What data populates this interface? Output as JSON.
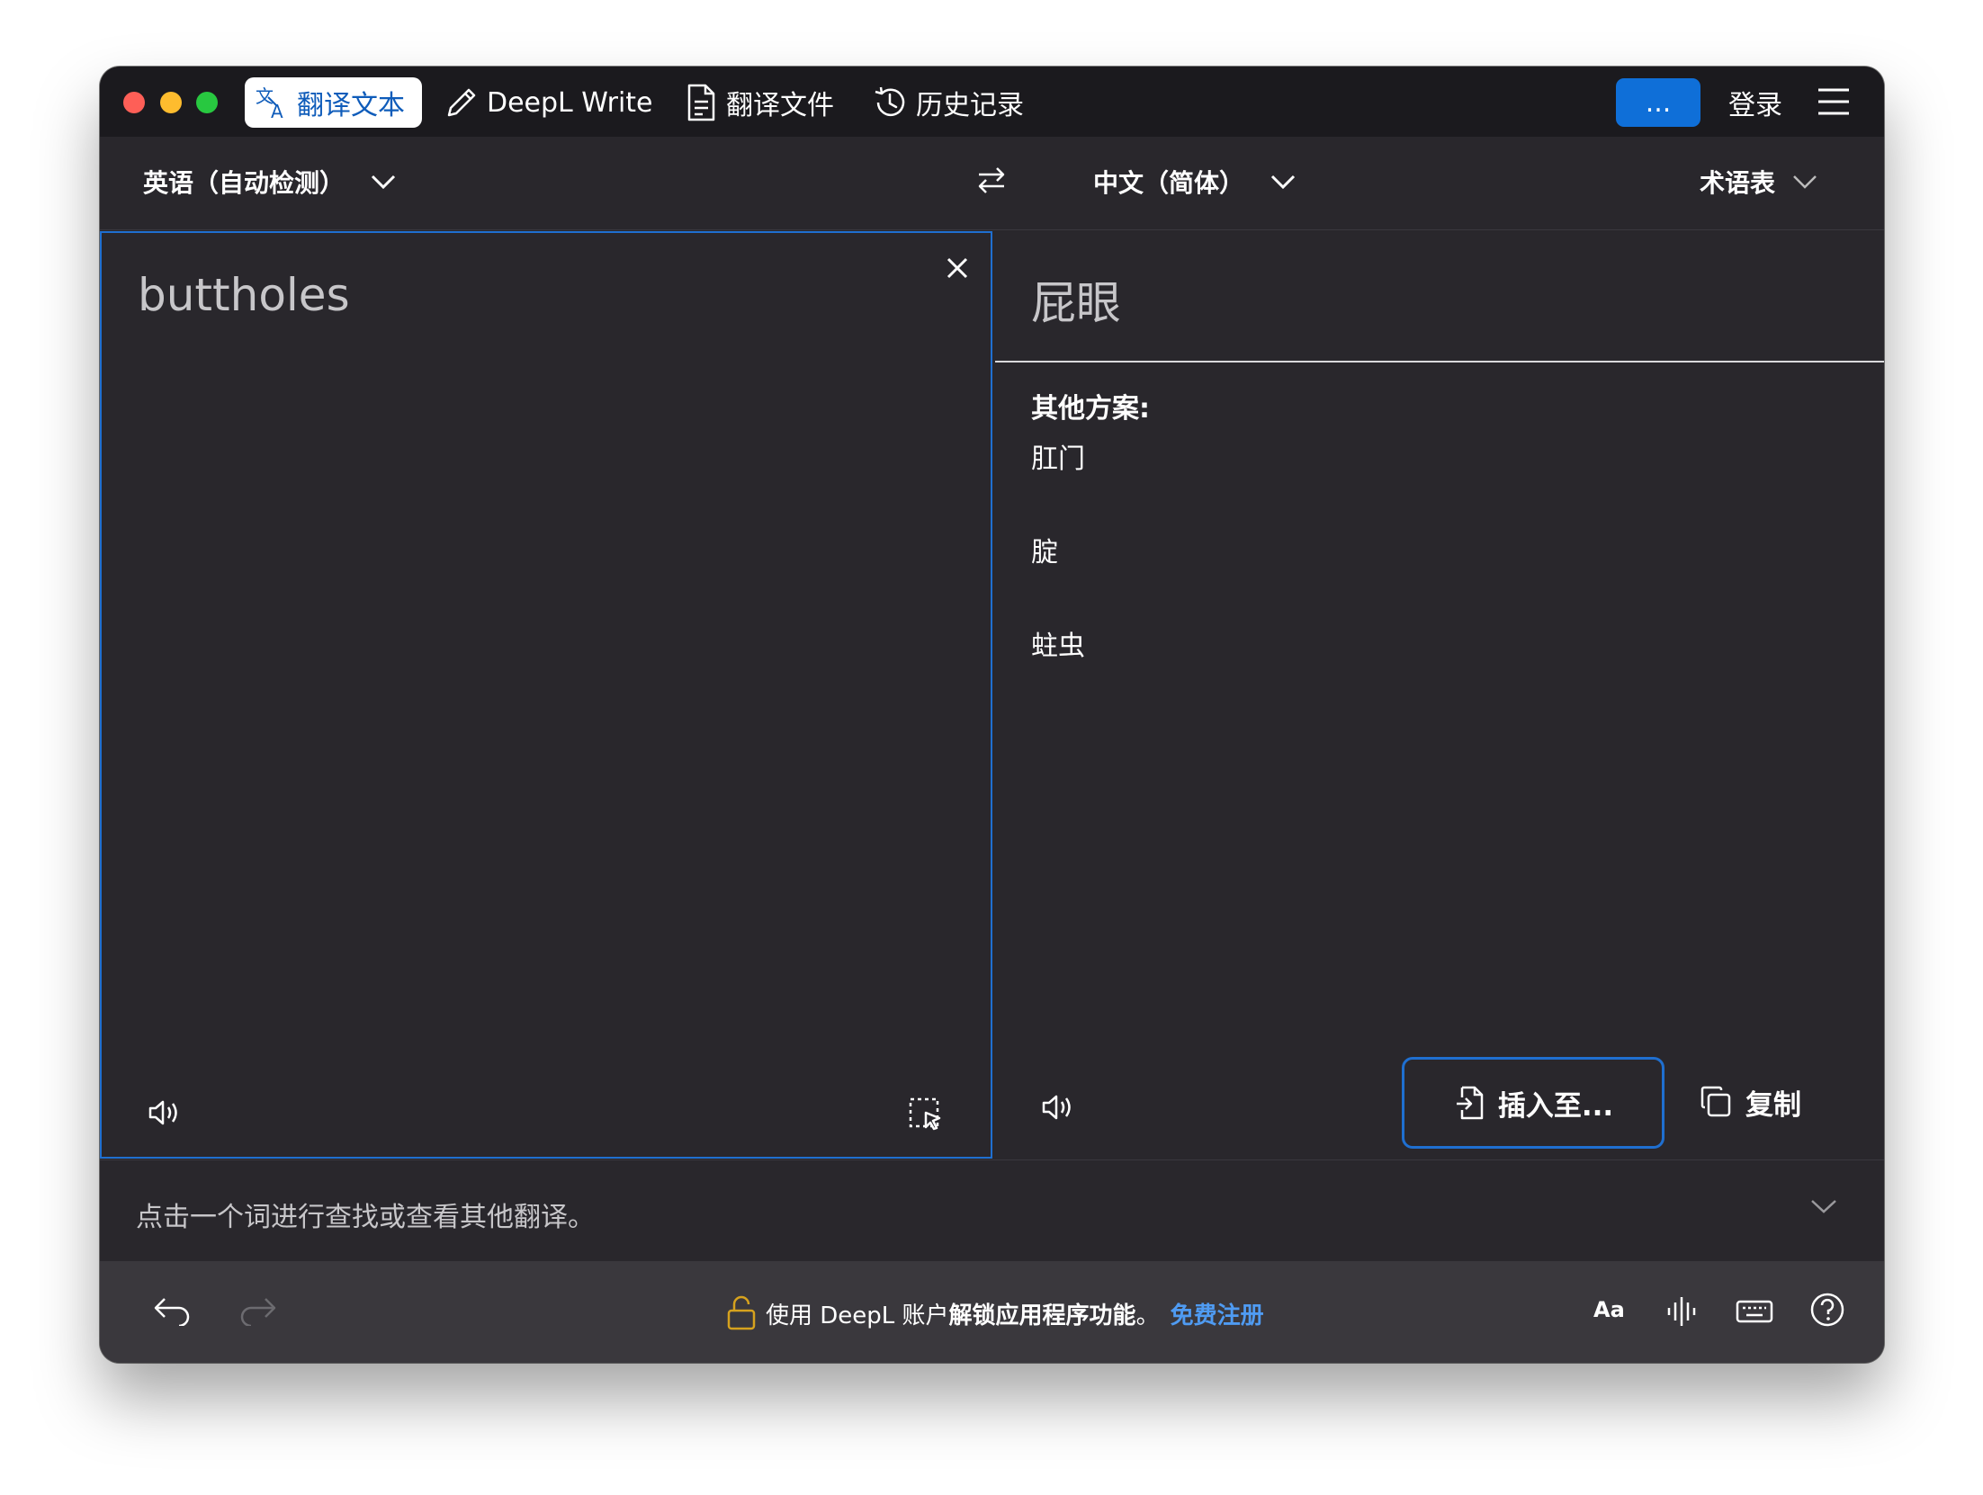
{
  "titlebar": {
    "tabs": [
      {
        "label": "翻译文本",
        "icon": "translate-icon",
        "active": true
      },
      {
        "label": "DeepL Write",
        "icon": "pen-icon"
      },
      {
        "label": "翻译文件",
        "icon": "document-icon"
      },
      {
        "label": "历史记录",
        "icon": "history-icon"
      }
    ],
    "more_label": "...",
    "login_label": "登录",
    "menu_icon": "hamburger-menu-icon"
  },
  "langbar": {
    "source_lang": "英语（自动检测）",
    "target_lang": "中文（简体）",
    "glossary_label": "术语表"
  },
  "source": {
    "text": "buttholes"
  },
  "target": {
    "main_translation": "屁眼",
    "alternatives_title": "其他方案:",
    "alternatives": [
      "肛门",
      "腚",
      "蛀虫"
    ],
    "insert_label": "插入至...",
    "copy_label": "复制"
  },
  "hint": {
    "text": "点击一个词进行查找或查看其他翻译。"
  },
  "bottombar": {
    "promo_prefix": "使用 DeepL 账户",
    "promo_bold": "解锁应用程序功能",
    "promo_suffix": "。",
    "promo_link": "免费注册",
    "text_size_label": "Aa"
  },
  "colors": {
    "accent": "#0f6fd8",
    "focus_border": "#1f6fd0",
    "window_bg": "#29272c",
    "titlebar_bg": "#1b1a1e",
    "link": "#4f9bf2",
    "lock": "#d6a21e"
  }
}
